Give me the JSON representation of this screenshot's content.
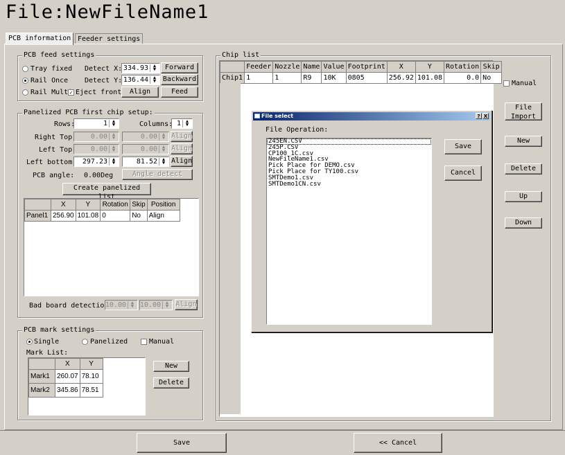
{
  "title": "File:NewFileName1",
  "tabs": [
    "PCB information",
    "Feeder settings"
  ],
  "feed": {
    "group_title": "PCB feed settings",
    "modes": [
      {
        "label": "Tray fixed",
        "selected": false
      },
      {
        "label": "Rail Once",
        "selected": true
      },
      {
        "label": "Rail Multi",
        "selected": false
      }
    ],
    "eject_front_label": "Eject front",
    "eject_front_checked": true,
    "detect_x_label": "Detect X:",
    "detect_x_value": "334.93",
    "detect_y_label": "Detect Y:",
    "detect_y_value": "136.44",
    "forward_label": "Forward",
    "backward_label": "Backward",
    "align_label": "Align",
    "feed_label": "Feed"
  },
  "panelized": {
    "group_title": "Panelized PCB first chip setup:",
    "rows_label": "Rows:",
    "rows_value": "1",
    "columns_label": "Columns:",
    "columns_value": "1",
    "right_top_label": "Right Top:",
    "right_top_x": "0.00",
    "right_top_y": "0.00",
    "left_top_label": "Left Top:",
    "left_top_x": "0.00",
    "left_top_y": "0.00",
    "left_bottom_label": "Left bottom:",
    "left_bottom_x": "297.23",
    "left_bottom_y": "81.52",
    "align_label": "Align",
    "angle_label": "PCB angle:",
    "angle_value": "0.00Deg",
    "angle_detect_label": "Angle detect",
    "create_label": "Create panelized list",
    "table_headers": [
      "",
      "X",
      "Y",
      "Rotation",
      "Skip",
      "Position"
    ],
    "table_rows": [
      [
        "Panel1",
        "256.90",
        "101.08",
        "0",
        "No",
        "Align"
      ]
    ],
    "bad_board_label": "Bad board detection:",
    "bad_board_x": "10.00",
    "bad_board_y": "10.00",
    "bad_board_align": "Align"
  },
  "mark": {
    "group_title": "PCB mark settings",
    "single_label": "Single",
    "panelized_label": "Panelized",
    "manual_label": "Manual",
    "mode": "Single",
    "list_label": "Mark List:",
    "table_headers": [
      "",
      "X",
      "Y"
    ],
    "table_rows": [
      [
        "Mark1",
        "260.07",
        "78.10"
      ],
      [
        "Mark2",
        "345.86",
        "78.51"
      ]
    ],
    "new_label": "New",
    "delete_label": "Delete"
  },
  "chip": {
    "group_title": "Chip list",
    "table_headers": [
      "",
      "Feeder",
      "Nozzle",
      "Name",
      "Value",
      "Footprint",
      "X",
      "Y",
      "Rotation",
      "Skip"
    ],
    "table_rows": [
      [
        "Chip1",
        "1",
        "1",
        "R9",
        "10K",
        "0805",
        "256.92",
        "101.08",
        "0.0",
        "No"
      ]
    ],
    "manual_label": "Manual",
    "file_import_label": "File Import",
    "new_label": "New",
    "delete_label": "Delete",
    "up_label": "Up",
    "down_label": "Down"
  },
  "dialog": {
    "title": "File select",
    "help_label": "?",
    "close_label": "X",
    "operation_label": "File Operation:",
    "files": [
      "245EN.CSV",
      "245P.CSV",
      "CP100_1C.csv",
      "NewFileName1.csv",
      "Pick Place for DEMO.csv",
      "Pick Place for TY100.csv",
      "SMTDemo1.csv",
      "SMTDemo1CN.csv"
    ],
    "selected_index": 0,
    "save_label": "Save",
    "cancel_label": "Cancel"
  },
  "footer": {
    "save_label": "Save",
    "cancel_label": "<< Cancel"
  }
}
